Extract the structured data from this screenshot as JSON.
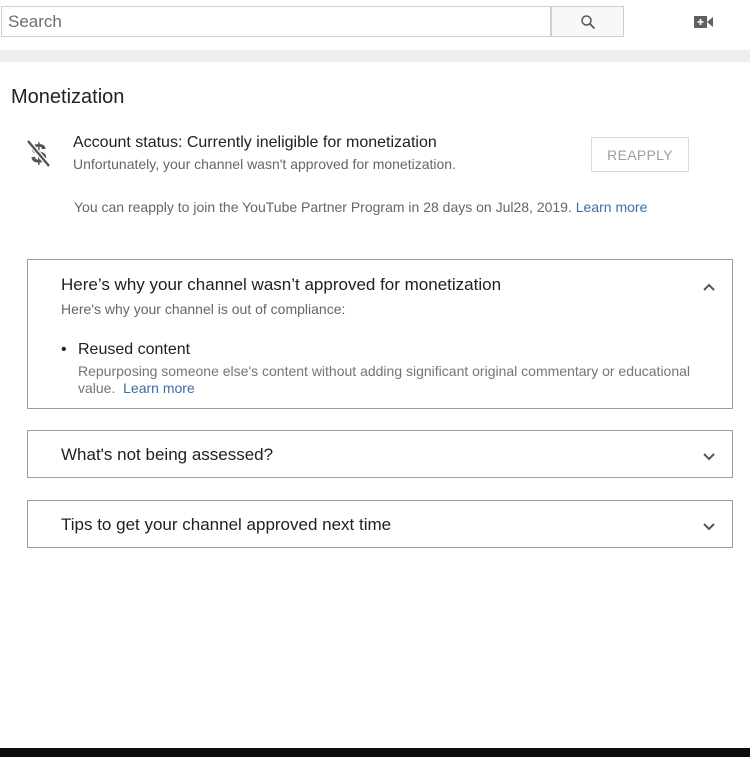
{
  "search": {
    "placeholder": "Search"
  },
  "header": {
    "search_button_icon": "search-icon",
    "camera_icon": "video-camera-add-icon"
  },
  "page": {
    "title": "Monetization"
  },
  "account_status": {
    "icon": "no-money-icon",
    "title": "Account status: Currently ineligible for monetization",
    "description": "Unfortunately, your channel wasn't approved for monetization.",
    "reapply_label": "REAPPLY",
    "reapply_note": "You can reapply to join the YouTube Partner Program in 28 days on Jul28, 2019.",
    "learn_more": "Learn more"
  },
  "panels": [
    {
      "title": "Here’s why your channel wasn’t approved for monetization",
      "expanded": true,
      "subtitle": "Here's why your channel is out of compliance:",
      "reasons": [
        {
          "label": "Reused content",
          "description": "Repurposing someone else's content without adding significant original commentary or educational value.",
          "learn_more": "Learn more"
        }
      ]
    },
    {
      "title": "What's not being assessed?",
      "expanded": false
    },
    {
      "title": "Tips to get your channel approved next time",
      "expanded": false
    }
  ],
  "colors": {
    "link": "#3c6ea7",
    "border": "#9e9e9e",
    "muted_text": "#666666"
  }
}
